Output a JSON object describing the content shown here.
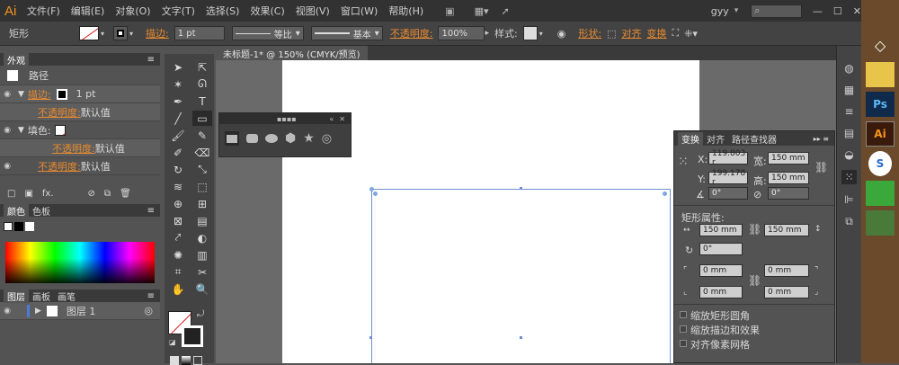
{
  "app": {
    "logo": "Ai",
    "user": "gyy"
  },
  "menu": [
    "文件(F)",
    "编辑(E)",
    "对象(O)",
    "文字(T)",
    "选择(S)",
    "效果(C)",
    "视图(V)",
    "窗口(W)",
    "帮助(H)"
  ],
  "control": {
    "object_type": "矩形",
    "stroke_label": "描边:",
    "stroke_weight": "1 pt",
    "profile": "等比",
    "brush": "基本",
    "opacity_label": "不透明度:",
    "opacity": "100%",
    "style_label": "样式:",
    "shape_link": "形状:",
    "align_link": "对齐",
    "transform_link": "变换"
  },
  "document_tab": "未标题-1* @ 150% (CMYK/预览)",
  "appearance": {
    "tab": "外观",
    "title": "路径",
    "stroke_label": "描边:",
    "stroke_value": "1 pt",
    "opacity_label": "不透明度:",
    "opacity_value": "默认值",
    "fill_label": "填色:",
    "fill_opacity_label": "不透明度:",
    "fill_opacity_value": "默认值",
    "path_opacity_label": "不透明度:",
    "path_opacity_value": "默认值"
  },
  "color_panel": {
    "tabs": [
      "颜色",
      "色板"
    ]
  },
  "layers_panel": {
    "tabs": [
      "图层",
      "画板",
      "画笔"
    ],
    "layer_name": "图层 1"
  },
  "transform": {
    "tabs": [
      "变换",
      "对齐",
      "路径查找器"
    ],
    "x_label": "X:",
    "x": "119.803 r",
    "y_label": "Y:",
    "y": "199.178 r",
    "w_label": "宽:",
    "w": "150 mm",
    "h_label": "高:",
    "h": "150 mm",
    "angle": "0°",
    "shear": "0°",
    "rect_props": "矩形属性:",
    "rect_w": "150 mm",
    "rect_h": "150 mm",
    "rect_angle": "0°",
    "r1": "0 mm",
    "r2": "0 mm",
    "r3": "0 mm",
    "r4": "0 mm",
    "check1": "缩放矩形圆角",
    "check2": "缩放描边和效果",
    "check3": "对齐像素网格"
  },
  "taskbar": [
    "Ai",
    "S",
    "Ps"
  ]
}
